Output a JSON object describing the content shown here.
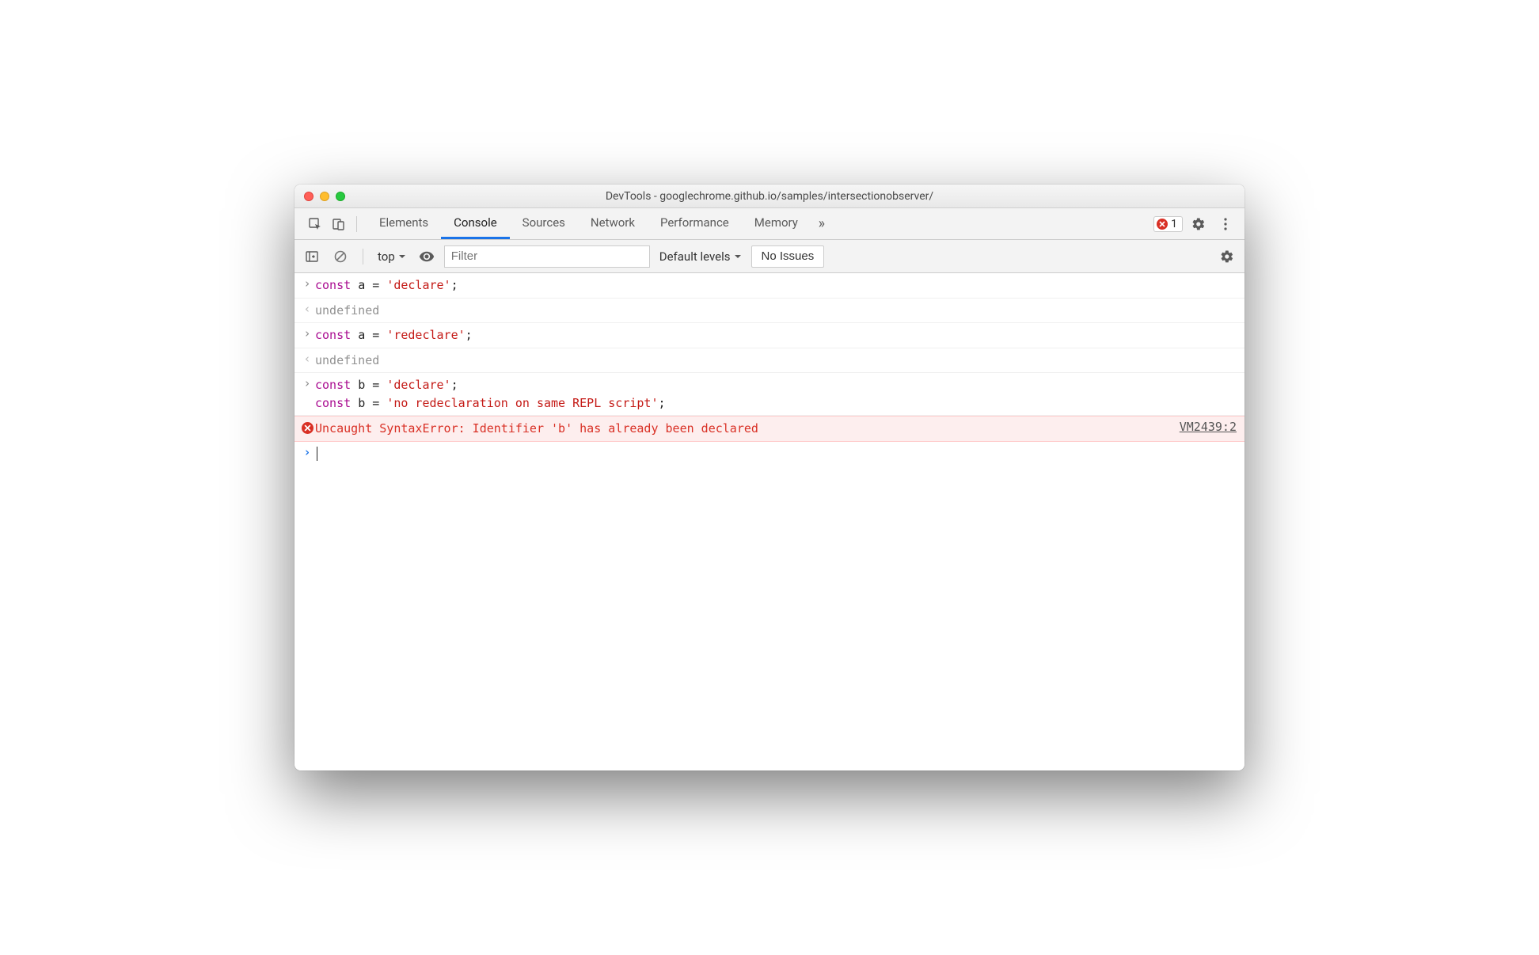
{
  "window": {
    "title": "DevTools - googlechrome.github.io/samples/intersectionobserver/"
  },
  "tabs": {
    "items": [
      "Elements",
      "Console",
      "Sources",
      "Network",
      "Performance",
      "Memory"
    ],
    "active": "Console",
    "overflow_glyph": "»"
  },
  "errors": {
    "count": "1"
  },
  "filterbar": {
    "context": "top",
    "filter_placeholder": "Filter",
    "levels_label": "Default levels",
    "issues_label": "No Issues"
  },
  "console": {
    "entries": [
      {
        "type": "input",
        "tokens": [
          {
            "t": "keyword",
            "v": "const"
          },
          {
            "t": "sp",
            "v": " "
          },
          {
            "t": "ident",
            "v": "a"
          },
          {
            "t": "sp",
            "v": " "
          },
          {
            "t": "op",
            "v": "="
          },
          {
            "t": "sp",
            "v": " "
          },
          {
            "t": "str",
            "v": "'declare'"
          },
          {
            "t": "op",
            "v": ";"
          }
        ]
      },
      {
        "type": "output",
        "text": "undefined"
      },
      {
        "type": "input",
        "tokens": [
          {
            "t": "keyword",
            "v": "const"
          },
          {
            "t": "sp",
            "v": " "
          },
          {
            "t": "ident",
            "v": "a"
          },
          {
            "t": "sp",
            "v": " "
          },
          {
            "t": "op",
            "v": "="
          },
          {
            "t": "sp",
            "v": " "
          },
          {
            "t": "str",
            "v": "'redeclare'"
          },
          {
            "t": "op",
            "v": ";"
          }
        ]
      },
      {
        "type": "output",
        "text": "undefined"
      },
      {
        "type": "input-multiline",
        "lines": [
          [
            {
              "t": "keyword",
              "v": "const"
            },
            {
              "t": "sp",
              "v": " "
            },
            {
              "t": "ident",
              "v": "b"
            },
            {
              "t": "sp",
              "v": " "
            },
            {
              "t": "op",
              "v": "="
            },
            {
              "t": "sp",
              "v": " "
            },
            {
              "t": "str",
              "v": "'declare'"
            },
            {
              "t": "op",
              "v": ";"
            }
          ],
          [
            {
              "t": "keyword",
              "v": "const"
            },
            {
              "t": "sp",
              "v": " "
            },
            {
              "t": "ident",
              "v": "b"
            },
            {
              "t": "sp",
              "v": " "
            },
            {
              "t": "op",
              "v": "="
            },
            {
              "t": "sp",
              "v": " "
            },
            {
              "t": "str",
              "v": "'no redeclaration on same REPL script'"
            },
            {
              "t": "op",
              "v": ";"
            }
          ]
        ]
      },
      {
        "type": "error",
        "text": "Uncaught SyntaxError: Identifier 'b' has already been declared",
        "link": "VM2439:2"
      },
      {
        "type": "prompt"
      }
    ]
  },
  "colors": {
    "accent": "#1a73e8",
    "error": "#d93025"
  }
}
